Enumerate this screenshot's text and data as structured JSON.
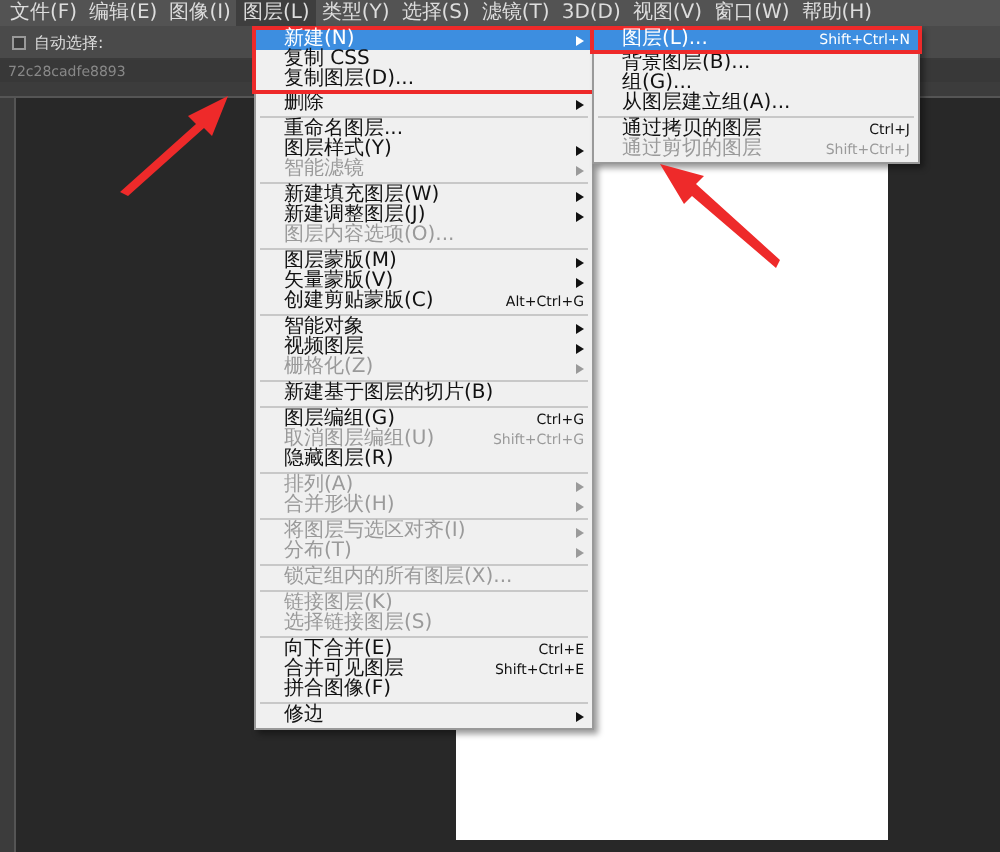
{
  "menubar": [
    {
      "label": "文件(F)",
      "selected": false
    },
    {
      "label": "编辑(E)",
      "selected": false
    },
    {
      "label": "图像(I)",
      "selected": false
    },
    {
      "label": "图层(L)",
      "selected": true
    },
    {
      "label": "类型(Y)",
      "selected": false
    },
    {
      "label": "选择(S)",
      "selected": false
    },
    {
      "label": "滤镜(T)",
      "selected": false
    },
    {
      "label": "3D(D)",
      "selected": false
    },
    {
      "label": "视图(V)",
      "selected": false
    },
    {
      "label": "窗口(W)",
      "selected": false
    },
    {
      "label": "帮助(H)",
      "selected": false
    }
  ],
  "options_bar": {
    "auto_select_label": "自动选择:",
    "auto_select_checked": false
  },
  "document_tab": {
    "title": "72c28cadfe8893"
  },
  "layer_menu": [
    {
      "kind": "item",
      "label": "新建(N)",
      "has_submenu": true,
      "disabled": false,
      "selected": true
    },
    {
      "kind": "item",
      "label": "复制 CSS",
      "has_submenu": false,
      "disabled": false,
      "selected": false
    },
    {
      "kind": "item",
      "label": "复制图层(D)...",
      "has_submenu": false,
      "disabled": false,
      "selected": false
    },
    {
      "kind": "item",
      "label": "删除",
      "has_submenu": true,
      "disabled": false,
      "selected": false
    },
    {
      "kind": "separator"
    },
    {
      "kind": "item",
      "label": "重命名图层...",
      "has_submenu": false,
      "disabled": false,
      "selected": false
    },
    {
      "kind": "item",
      "label": "图层样式(Y)",
      "has_submenu": true,
      "disabled": false,
      "selected": false
    },
    {
      "kind": "item",
      "label": "智能滤镜",
      "has_submenu": true,
      "disabled": true,
      "selected": false
    },
    {
      "kind": "separator"
    },
    {
      "kind": "item",
      "label": "新建填充图层(W)",
      "has_submenu": true,
      "disabled": false,
      "selected": false
    },
    {
      "kind": "item",
      "label": "新建调整图层(J)",
      "has_submenu": true,
      "disabled": false,
      "selected": false
    },
    {
      "kind": "item",
      "label": "图层内容选项(O)...",
      "has_submenu": false,
      "disabled": true,
      "selected": false
    },
    {
      "kind": "separator"
    },
    {
      "kind": "item",
      "label": "图层蒙版(M)",
      "has_submenu": true,
      "disabled": false,
      "selected": false
    },
    {
      "kind": "item",
      "label": "矢量蒙版(V)",
      "has_submenu": true,
      "disabled": false,
      "selected": false
    },
    {
      "kind": "item",
      "label": "创建剪贴蒙版(C)",
      "shortcut": "Alt+Ctrl+G",
      "has_submenu": false,
      "disabled": false,
      "selected": false
    },
    {
      "kind": "separator"
    },
    {
      "kind": "item",
      "label": "智能对象",
      "has_submenu": true,
      "disabled": false,
      "selected": false
    },
    {
      "kind": "item",
      "label": "视频图层",
      "has_submenu": true,
      "disabled": false,
      "selected": false
    },
    {
      "kind": "item",
      "label": "栅格化(Z)",
      "has_submenu": true,
      "disabled": true,
      "selected": false
    },
    {
      "kind": "separator"
    },
    {
      "kind": "item",
      "label": "新建基于图层的切片(B)",
      "has_submenu": false,
      "disabled": false,
      "selected": false
    },
    {
      "kind": "separator"
    },
    {
      "kind": "item",
      "label": "图层编组(G)",
      "shortcut": "Ctrl+G",
      "has_submenu": false,
      "disabled": false,
      "selected": false
    },
    {
      "kind": "item",
      "label": "取消图层编组(U)",
      "shortcut": "Shift+Ctrl+G",
      "has_submenu": false,
      "disabled": true,
      "selected": false
    },
    {
      "kind": "item",
      "label": "隐藏图层(R)",
      "has_submenu": false,
      "disabled": false,
      "selected": false
    },
    {
      "kind": "separator"
    },
    {
      "kind": "item",
      "label": "排列(A)",
      "has_submenu": true,
      "disabled": true,
      "selected": false
    },
    {
      "kind": "item",
      "label": "合并形状(H)",
      "has_submenu": true,
      "disabled": true,
      "selected": false
    },
    {
      "kind": "separator"
    },
    {
      "kind": "item",
      "label": "将图层与选区对齐(I)",
      "has_submenu": true,
      "disabled": true,
      "selected": false
    },
    {
      "kind": "item",
      "label": "分布(T)",
      "has_submenu": true,
      "disabled": true,
      "selected": false
    },
    {
      "kind": "separator"
    },
    {
      "kind": "item",
      "label": "锁定组内的所有图层(X)...",
      "has_submenu": false,
      "disabled": true,
      "selected": false
    },
    {
      "kind": "separator"
    },
    {
      "kind": "item",
      "label": "链接图层(K)",
      "has_submenu": false,
      "disabled": true,
      "selected": false
    },
    {
      "kind": "item",
      "label": "选择链接图层(S)",
      "has_submenu": false,
      "disabled": true,
      "selected": false
    },
    {
      "kind": "separator"
    },
    {
      "kind": "item",
      "label": "向下合并(E)",
      "shortcut": "Ctrl+E",
      "has_submenu": false,
      "disabled": false,
      "selected": false
    },
    {
      "kind": "item",
      "label": "合并可见图层",
      "shortcut": "Shift+Ctrl+E",
      "has_submenu": false,
      "disabled": false,
      "selected": false
    },
    {
      "kind": "item",
      "label": "拼合图像(F)",
      "has_submenu": false,
      "disabled": false,
      "selected": false
    },
    {
      "kind": "separator"
    },
    {
      "kind": "item",
      "label": "修边",
      "has_submenu": true,
      "disabled": false,
      "selected": false
    }
  ],
  "new_submenu": [
    {
      "kind": "item",
      "label": "图层(L)...",
      "shortcut": "Shift+Ctrl+N",
      "has_submenu": false,
      "disabled": false,
      "selected": true
    },
    {
      "kind": "item",
      "label": "背景图层(B)...",
      "has_submenu": false,
      "disabled": false,
      "selected": false
    },
    {
      "kind": "item",
      "label": "组(G)...",
      "has_submenu": false,
      "disabled": false,
      "selected": false
    },
    {
      "kind": "item",
      "label": "从图层建立组(A)...",
      "has_submenu": false,
      "disabled": false,
      "selected": false
    },
    {
      "kind": "separator"
    },
    {
      "kind": "item",
      "label": "通过拷贝的图层",
      "shortcut": "Ctrl+J",
      "has_submenu": false,
      "disabled": false,
      "selected": false
    },
    {
      "kind": "item",
      "label": "通过剪切的图层",
      "shortcut": "Shift+Ctrl+J",
      "has_submenu": false,
      "disabled": true,
      "selected": false
    }
  ]
}
